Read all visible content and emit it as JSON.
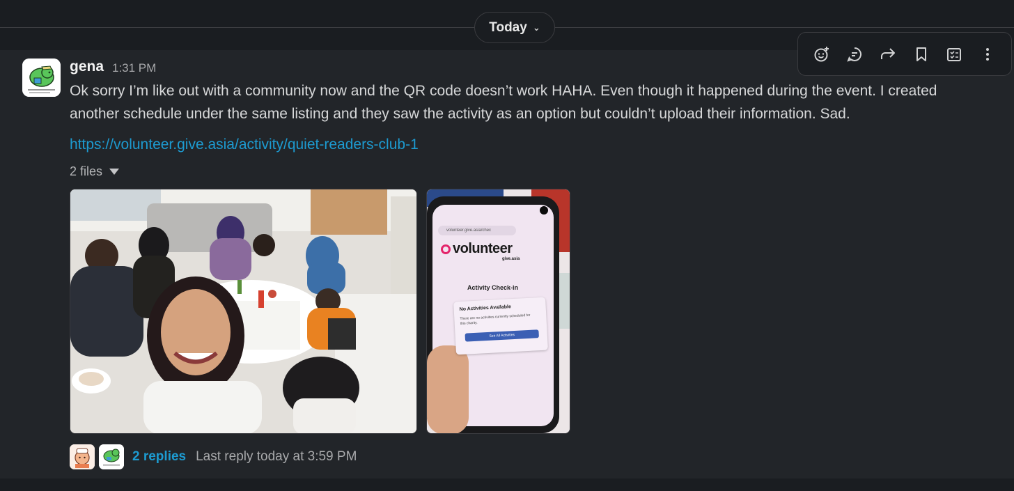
{
  "divider": {
    "label": "Today"
  },
  "message": {
    "author": "gena",
    "time": "1:31 PM",
    "text": "Ok sorry I’m like out with a community now and  the QR code doesn’t work HAHA. Even though it happened during the event. I created another schedule under the same listing and they saw the activity as an option but couldn’t upload their information. Sad.",
    "link": "https://volunteer.give.asia/activity/quiet-readers-club-1",
    "files_label": "2 files"
  },
  "phone": {
    "url": "volunteer.give.asia/chec",
    "brand": "volunteer",
    "sub": "give.asia",
    "heading": "Activity Check-in",
    "card_title": "No Activities Available",
    "card_text": "There are no activities currently scheduled for this charity.",
    "button": "See All Activities"
  },
  "thread": {
    "replies": "2 replies",
    "last_reply": "Last reply today at 3:59 PM"
  },
  "colors": {
    "link": "#1d9bd1",
    "brand": "#e4246b",
    "button": "#3b5fb4"
  },
  "toolbar_icons": [
    "add-reaction-icon",
    "reply-in-thread-icon",
    "forward-icon",
    "save-bookmark-icon",
    "add-to-list-icon",
    "more-actions-icon"
  ]
}
